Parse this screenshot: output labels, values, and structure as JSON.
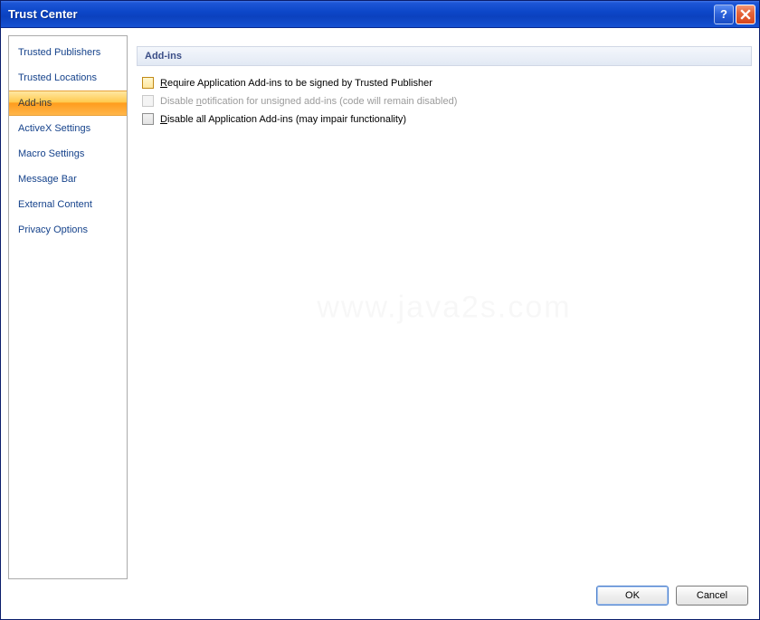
{
  "titlebar": {
    "title": "Trust Center",
    "help_char": "?",
    "close_char": "X"
  },
  "sidebar": {
    "items": [
      {
        "label": "Trusted Publishers",
        "selected": false
      },
      {
        "label": "Trusted Locations",
        "selected": false
      },
      {
        "label": "Add-ins",
        "selected": true
      },
      {
        "label": "ActiveX Settings",
        "selected": false
      },
      {
        "label": "Macro Settings",
        "selected": false
      },
      {
        "label": "Message Bar",
        "selected": false
      },
      {
        "label": "External Content",
        "selected": false
      },
      {
        "label": "Privacy Options",
        "selected": false
      }
    ]
  },
  "panel": {
    "header": "Add-ins",
    "options": [
      {
        "accel": "R",
        "rest": "equire Application Add-ins to be signed by Trusted Publisher",
        "enabled": true,
        "focused": true
      },
      {
        "pre": "Disable ",
        "accel": "n",
        "rest": "otification for unsigned add-ins (code will remain disabled)",
        "enabled": false,
        "focused": false
      },
      {
        "accel": "D",
        "rest": "isable all Application Add-ins (may impair functionality)",
        "enabled": true,
        "focused": false
      }
    ]
  },
  "watermark": "www.java2s.com",
  "buttons": {
    "ok": "OK",
    "cancel": "Cancel"
  }
}
